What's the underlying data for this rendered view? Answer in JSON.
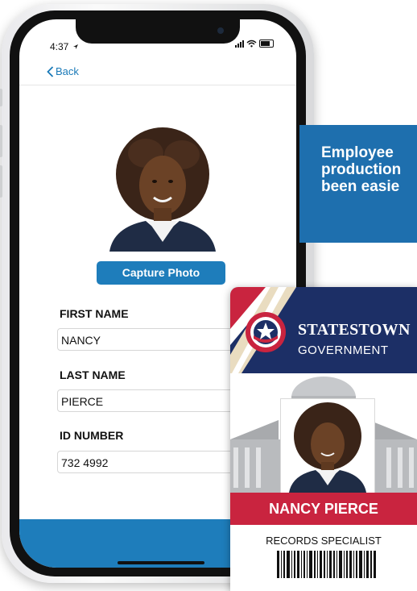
{
  "status": {
    "time": "4:37"
  },
  "nav": {
    "back_label": "Back"
  },
  "form": {
    "capture_label": "Capture Photo",
    "fields": [
      {
        "label": "FIRST NAME",
        "value": "NANCY"
      },
      {
        "label": "LAST NAME",
        "value": "PIERCE"
      },
      {
        "label": "ID NUMBER",
        "value": "732 4992"
      }
    ]
  },
  "banner": {
    "lines": [
      "Employee",
      "production",
      "been easie"
    ]
  },
  "card": {
    "org_name": "STATESTOWN",
    "org_sub": "GOVERNMENT",
    "person_name": "NANCY PIERCE",
    "job_title": "RECORDS SPECIALIST"
  },
  "colors": {
    "accent_blue": "#1e7dbb",
    "card_navy": "#1c2f66",
    "card_red": "#c9243f"
  }
}
